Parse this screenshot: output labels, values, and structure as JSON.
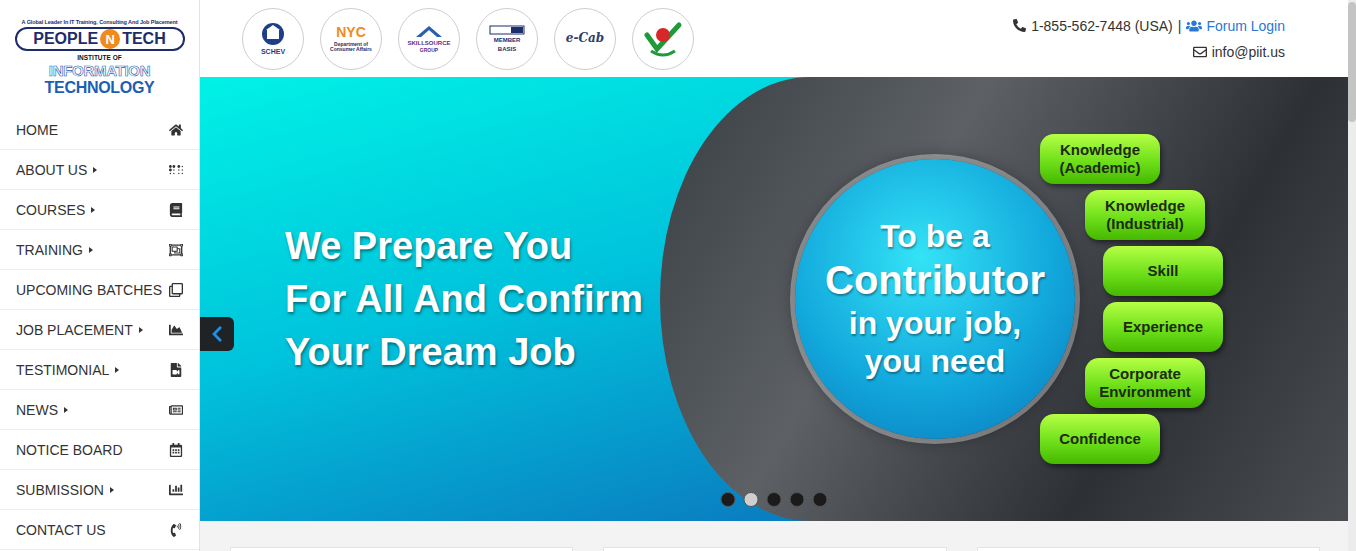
{
  "logo": {
    "tagline": "A Global Leader In IT Training, Consulting And Job Placement",
    "brand_left": "PEOPLE",
    "brand_mid": "N",
    "brand_right": "TECH",
    "institute_of": "INSTITUTE OF",
    "line1": "INFORMATION",
    "line2": "TECHNOLOGY"
  },
  "sidebar": {
    "items": [
      {
        "label": "HOME",
        "has_submenu": false,
        "selected": false
      },
      {
        "label": "ABOUT US",
        "has_submenu": true,
        "selected": false
      },
      {
        "label": "COURSES",
        "has_submenu": true,
        "selected": false
      },
      {
        "label": "TRAINING",
        "has_submenu": true,
        "selected": false
      },
      {
        "label": "UPCOMING BATCHES",
        "has_submenu": false,
        "selected": false
      },
      {
        "label": "JOB PLACEMENT",
        "has_submenu": true,
        "selected": false
      },
      {
        "label": "TESTIMONIAL",
        "has_submenu": true,
        "selected": false
      },
      {
        "label": "NEWS",
        "has_submenu": true,
        "selected": false
      },
      {
        "label": "NOTICE BOARD",
        "has_submenu": false,
        "selected": false
      },
      {
        "label": "SUBMISSION",
        "has_submenu": true,
        "selected": false
      },
      {
        "label": "CONTACT US",
        "has_submenu": false,
        "selected": false
      }
    ]
  },
  "partner_logos": [
    {
      "lines": [
        "SCHEV"
      ]
    },
    {
      "lines": [
        "NYC",
        "Department of Consumer Affairs"
      ]
    },
    {
      "lines": [
        "SKILLSOURCE",
        "GROUP"
      ]
    },
    {
      "lines": [
        "MEMBER",
        "BASIS"
      ]
    },
    {
      "lines": [
        "e-Cab"
      ]
    },
    {
      "lines": []
    }
  ],
  "contact": {
    "phone": "1-855-562-7448 (USA)",
    "separator": "|",
    "forum_login": "Forum Login",
    "email": "info@piit.us"
  },
  "slider": {
    "headline": [
      "We Prepare You",
      "For All And Confirm",
      "Your Dream Job"
    ],
    "circle": [
      "To be a",
      "Contributor",
      "in your job,",
      "you need"
    ],
    "pills": [
      {
        "lines": [
          "Knowledge",
          "(Academic)"
        ]
      },
      {
        "lines": [
          "Knowledge",
          "(Industrial)"
        ]
      },
      {
        "lines": [
          "Skill"
        ]
      },
      {
        "lines": [
          "Experience"
        ]
      },
      {
        "lines": [
          "Corporate",
          "Environment"
        ]
      },
      {
        "lines": [
          "Confidence"
        ]
      }
    ],
    "dots": [
      {
        "selected": false
      },
      {
        "selected": true
      },
      {
        "selected": false
      },
      {
        "selected": false
      },
      {
        "selected": false
      }
    ]
  }
}
